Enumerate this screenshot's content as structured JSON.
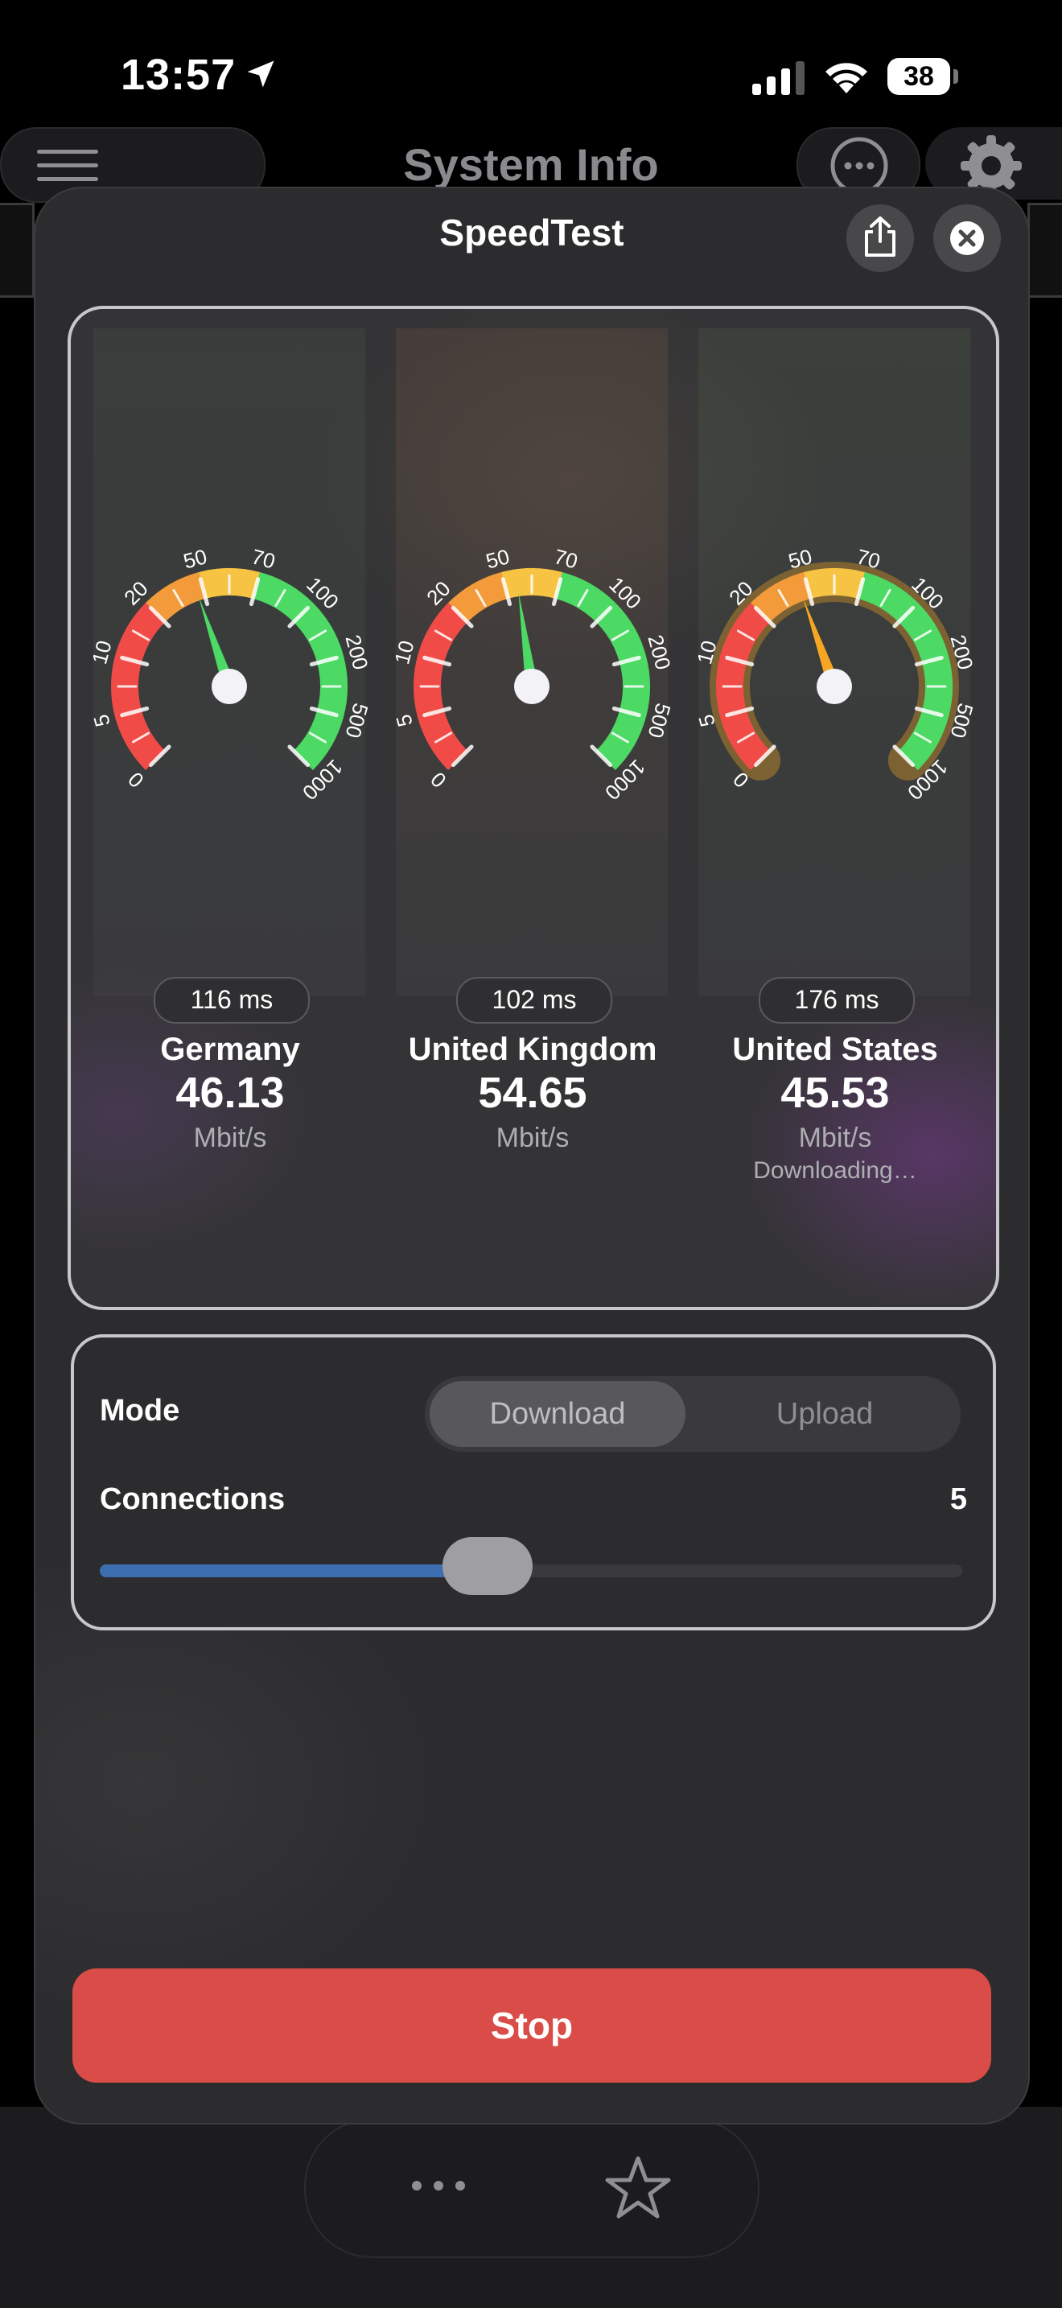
{
  "status_bar": {
    "time": "13:57",
    "battery": "38"
  },
  "app": {
    "title": "System Info"
  },
  "sheet": {
    "title": "SpeedTest"
  },
  "gauge_scale": [
    "0",
    "5",
    "10",
    "20",
    "50",
    "70",
    "100",
    "200",
    "500",
    "1000"
  ],
  "gauges": [
    {
      "ping": "116 ms",
      "country": "Germany",
      "speed": "46.13",
      "unit": "Mbit/s",
      "state": "",
      "needle_color": "#4cd964",
      "active": false
    },
    {
      "ping": "102 ms",
      "country": "United Kingdom",
      "speed": "54.65",
      "unit": "Mbit/s",
      "state": "",
      "needle_color": "#4cd964",
      "active": false
    },
    {
      "ping": "176 ms",
      "country": "United States",
      "speed": "45.53",
      "unit": "Mbit/s",
      "state": "Downloading…",
      "needle_color": "#f5a623",
      "active": true
    }
  ],
  "settings": {
    "mode_label": "Mode",
    "mode_options": [
      "Download",
      "Upload"
    ],
    "mode_selected": "Download",
    "connections_label": "Connections",
    "connections_value": "5",
    "connections_fraction": 0.45
  },
  "actions": {
    "stop_label": "Stop"
  },
  "colors": {
    "red": "#f04b47",
    "orange": "#f39a3b",
    "yellow": "#f6c343",
    "green": "#4cd964",
    "stop": "#d94c47",
    "slider": "#3d6fb0"
  },
  "icons": {
    "location": "location-arrow-icon",
    "signal": "cellular-signal-icon",
    "wifi": "wifi-icon",
    "menu": "hamburger-menu-icon",
    "more": "ellipsis-circle-icon",
    "settings": "gear-icon",
    "share": "share-icon",
    "close": "close-icon",
    "dots": "more-dots-icon",
    "favorite": "star-icon"
  }
}
